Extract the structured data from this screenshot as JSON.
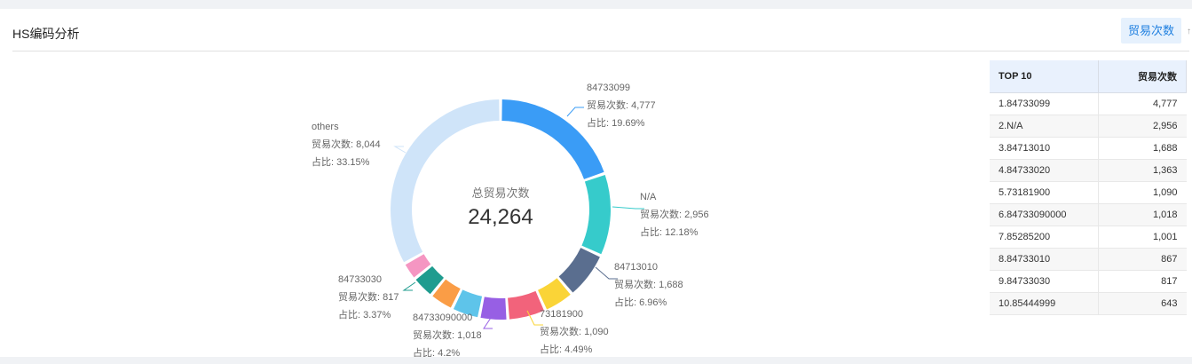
{
  "header": {
    "title": "HS编码分析",
    "tab_label": "贸易次数",
    "more_label": "↑"
  },
  "chart_data": {
    "type": "pie",
    "donut": true,
    "center_title": "总贸易次数",
    "center_value": "24,264",
    "metric_label": "贸易次数",
    "share_label": "占比",
    "slices": [
      {
        "name": "84733099",
        "value": 4777,
        "value_text": "4,777",
        "share": "19.69%",
        "color": "#3a9cf6"
      },
      {
        "name": "N/A",
        "value": 2956,
        "value_text": "2,956",
        "share": "12.18%",
        "color": "#36cbcb"
      },
      {
        "name": "84713010",
        "value": 1688,
        "value_text": "1,688",
        "share": "6.96%",
        "color": "#5a6e8f"
      },
      {
        "name": "73181900",
        "value": 1090,
        "value_text": "1,090",
        "share": "4.49%",
        "color": "#fad437"
      },
      {
        "name": "84733020",
        "value": 1363,
        "value_text": "1,363",
        "share": "5.62%",
        "color": "#f2637b"
      },
      {
        "name": "84733090000",
        "value": 1018,
        "value_text": "1,018",
        "share": "4.2%",
        "color": "#975fe4"
      },
      {
        "name": "85285200",
        "value": 1001,
        "value_text": "1,001",
        "share": "4.13%",
        "color": "#5ec4ea"
      },
      {
        "name": "84733010",
        "value": 867,
        "value_text": "867",
        "share": "3.57%",
        "color": "#fa9d46"
      },
      {
        "name": "84733030",
        "value": 817,
        "value_text": "817",
        "share": "3.37%",
        "color": "#1f9c8f"
      },
      {
        "name": "85444999",
        "value": 643,
        "value_text": "643",
        "share": "2.65%",
        "color": "#f596c2"
      },
      {
        "name": "others",
        "value": 8044,
        "value_text": "8,044",
        "share": "33.15%",
        "color": "#cfe4f9"
      }
    ],
    "labeled": [
      "84733099",
      "N/A",
      "84713010",
      "73181900",
      "84733090000",
      "84733030",
      "others"
    ]
  },
  "table": {
    "header": [
      "TOP 10",
      "贸易次数"
    ],
    "rows": [
      [
        "1.84733099",
        "4,777"
      ],
      [
        "2.N/A",
        "2,956"
      ],
      [
        "3.84713010",
        "1,688"
      ],
      [
        "4.84733020",
        "1,363"
      ],
      [
        "5.73181900",
        "1,090"
      ],
      [
        "6.84733090000",
        "1,018"
      ],
      [
        "7.85285200",
        "1,001"
      ],
      [
        "8.84733010",
        "867"
      ],
      [
        "9.84733030",
        "817"
      ],
      [
        "10.85444999",
        "643"
      ]
    ]
  }
}
